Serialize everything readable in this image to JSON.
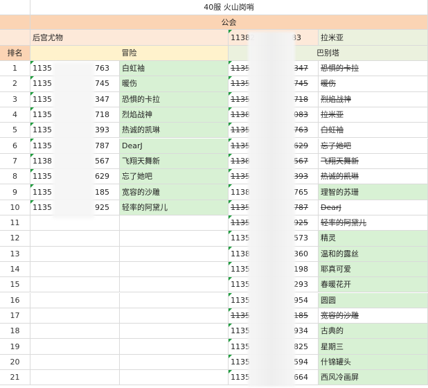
{
  "sheet": {
    "title": "40服 火山岗哨",
    "guild_header": "公会",
    "left_guild": {
      "id_prefix": "",
      "name": "后宫尤物"
    },
    "right_guild": {
      "id_prefix": "11382",
      "id_suffix": "83",
      "name": "拉米亚"
    },
    "rank_header": "排名",
    "left_section": "冒险",
    "right_section": "巴别塔",
    "rows": [
      {
        "rank": "1",
        "l_prefix": "1135",
        "l_suffix": "763",
        "l_name": "白虹袖",
        "r_prefix": "1135",
        "r_suffix": "347",
        "r_name": "恐惧的卡拉",
        "r_strike": true,
        "r_green": false
      },
      {
        "rank": "2",
        "l_prefix": "1135",
        "l_suffix": "745",
        "l_name": "暖伤",
        "r_prefix": "1135",
        "r_suffix": "745",
        "r_name": "暖伤",
        "r_strike": true,
        "r_green": false
      },
      {
        "rank": "3",
        "l_prefix": "1135",
        "l_suffix": "347",
        "l_name": "恐惧的卡拉",
        "r_prefix": "1135",
        "r_suffix": "718",
        "r_name": "烈焰战神",
        "r_strike": true,
        "r_green": false
      },
      {
        "rank": "4",
        "l_prefix": "1135",
        "l_suffix": "718",
        "l_name": "烈焰战神",
        "r_prefix": "1138",
        "r_suffix": "083",
        "r_name": "拉米亚",
        "r_strike": true,
        "r_green": false
      },
      {
        "rank": "5",
        "l_prefix": "1135",
        "l_suffix": "393",
        "l_name": "热诚的凯琳",
        "r_prefix": "1135",
        "r_suffix": "763",
        "r_name": "白虹袖",
        "r_strike": true,
        "r_green": false
      },
      {
        "rank": "6",
        "l_prefix": "1135",
        "l_suffix": "787",
        "l_name": "DearJ",
        "r_prefix": "1135",
        "r_suffix": "629",
        "r_name": "忘了她吧",
        "r_strike": true,
        "r_green": false
      },
      {
        "rank": "7",
        "l_prefix": "1138",
        "l_suffix": "567",
        "l_name": "飞翔天舞新",
        "r_prefix": "1138",
        "r_suffix": "567",
        "r_name": "飞翔天舞新",
        "r_strike": true,
        "r_green": false
      },
      {
        "rank": "8",
        "l_prefix": "1135",
        "l_suffix": "629",
        "l_name": "忘了她吧",
        "r_prefix": "1135",
        "r_suffix": "393",
        "r_name": "热诚的凯琳",
        "r_strike": true,
        "r_green": false
      },
      {
        "rank": "9",
        "l_prefix": "1135",
        "l_suffix": "185",
        "l_name": "宽容的沙雕",
        "r_prefix": "1138",
        "r_suffix": "765",
        "r_name": "理智的苏珊",
        "r_strike": false,
        "r_green": true
      },
      {
        "rank": "10",
        "l_prefix": "1135",
        "l_suffix": "925",
        "l_name": "轻率的阿黛儿",
        "r_prefix": "1135",
        "r_suffix": "787",
        "r_name": "DearJ",
        "r_strike": true,
        "r_green": false
      },
      {
        "rank": "11",
        "l_prefix": "",
        "l_suffix": "",
        "l_name": "",
        "r_prefix": "1135",
        "r_suffix": "925",
        "r_name": "轻率的阿黛儿",
        "r_strike": true,
        "r_green": false
      },
      {
        "rank": "12",
        "l_prefix": "",
        "l_suffix": "",
        "l_name": "",
        "r_prefix": "1135",
        "r_suffix": "573",
        "r_name": "精灵",
        "r_strike": false,
        "r_green": true
      },
      {
        "rank": "13",
        "l_prefix": "",
        "l_suffix": "",
        "l_name": "",
        "r_prefix": "1138",
        "r_suffix": "360",
        "r_name": "温和的露丝",
        "r_strike": false,
        "r_green": true
      },
      {
        "rank": "14",
        "l_prefix": "",
        "l_suffix": "",
        "l_name": "",
        "r_prefix": "1135",
        "r_suffix": "198",
        "r_name": "耶真可爱",
        "r_strike": false,
        "r_green": true
      },
      {
        "rank": "15",
        "l_prefix": "",
        "l_suffix": "",
        "l_name": "",
        "r_prefix": "1135",
        "r_suffix": "293",
        "r_name": "春暖花开",
        "r_strike": false,
        "r_green": true
      },
      {
        "rank": "16",
        "l_prefix": "",
        "l_suffix": "",
        "l_name": "",
        "r_prefix": "1135",
        "r_suffix": "954",
        "r_name": "圆圆",
        "r_strike": false,
        "r_green": true
      },
      {
        "rank": "17",
        "l_prefix": "",
        "l_suffix": "",
        "l_name": "",
        "r_prefix": "1135",
        "r_suffix": "185",
        "r_name": "宽容的沙雕",
        "r_strike": true,
        "r_green": false
      },
      {
        "rank": "18",
        "l_prefix": "",
        "l_suffix": "",
        "l_name": "",
        "r_prefix": "1135",
        "r_suffix": "934",
        "r_name": "古典的",
        "r_strike": false,
        "r_green": true
      },
      {
        "rank": "19",
        "l_prefix": "",
        "l_suffix": "",
        "l_name": "",
        "r_prefix": "1135",
        "r_suffix": "825",
        "r_name": "星期三",
        "r_strike": false,
        "r_green": true
      },
      {
        "rank": "20",
        "l_prefix": "",
        "l_suffix": "",
        "l_name": "",
        "r_prefix": "1135",
        "r_suffix": "594",
        "r_name": "什锦罐头",
        "r_strike": false,
        "r_green": true
      },
      {
        "rank": "21",
        "l_prefix": "",
        "l_suffix": "",
        "l_name": "",
        "r_prefix": "1135",
        "r_suffix": "664",
        "r_name": "西风冷画屏",
        "r_strike": false,
        "r_green": true
      }
    ]
  }
}
